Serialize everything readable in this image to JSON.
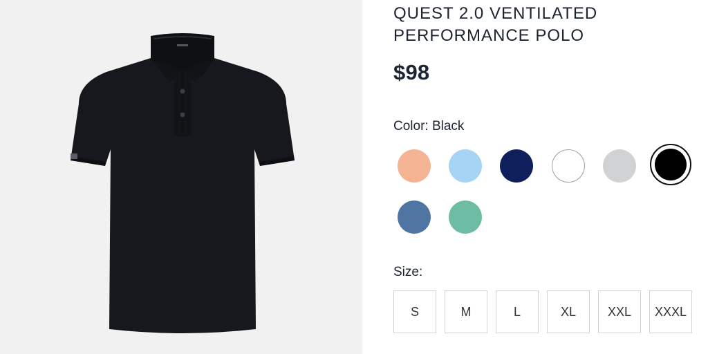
{
  "product": {
    "title_line1": "QUEST 2.0 VENTILATED",
    "title_line2": "PERFORMANCE POLO",
    "price": "$98",
    "image_name": "black-polo-shirt"
  },
  "color": {
    "label": "Color: Black",
    "selected": "Black",
    "swatches": [
      {
        "name": "peach",
        "hex": "#f4b493"
      },
      {
        "name": "light-blue",
        "hex": "#a6d4f5"
      },
      {
        "name": "navy",
        "hex": "#0f1f5c"
      },
      {
        "name": "white",
        "hex": "#ffffff"
      },
      {
        "name": "gray",
        "hex": "#d0d2d4"
      },
      {
        "name": "black",
        "hex": "#000000"
      },
      {
        "name": "slate-blue",
        "hex": "#4f76a3"
      },
      {
        "name": "seafoam",
        "hex": "#6cbda3"
      }
    ]
  },
  "size": {
    "label": "Size:",
    "options": [
      "S",
      "M",
      "L",
      "XL",
      "XXL",
      "XXXL"
    ]
  },
  "colors": {
    "text": "#1b2430",
    "image_bg": "#f1f1f1",
    "shirt": "#16181d"
  }
}
